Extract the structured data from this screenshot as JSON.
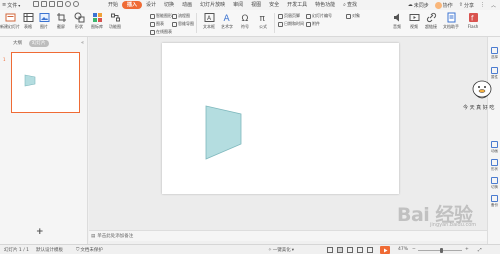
{
  "titlebar": {
    "file_menu": "文件",
    "tabs": [
      {
        "label": "开始",
        "active": false
      },
      {
        "label": "插入",
        "active": true
      },
      {
        "label": "设计",
        "active": false
      },
      {
        "label": "切换",
        "active": false
      },
      {
        "label": "动画",
        "active": false
      },
      {
        "label": "幻灯片放映",
        "active": false
      },
      {
        "label": "审阅",
        "active": false
      },
      {
        "label": "视图",
        "active": false
      },
      {
        "label": "安全",
        "active": false
      },
      {
        "label": "开发工具",
        "active": false
      },
      {
        "label": "特色功能",
        "active": false
      },
      {
        "label": "查找",
        "active": false
      }
    ],
    "right": {
      "collab": "未同步",
      "cooperate": "协作",
      "share": "分享"
    }
  },
  "ribbon": {
    "buttons": [
      {
        "label": "新建幻灯片",
        "icon": "new-slide-icon"
      },
      {
        "label": "表格",
        "icon": "table-icon"
      },
      {
        "label": "图片",
        "icon": "picture-icon"
      },
      {
        "label": "截屏",
        "icon": "screenshot-icon"
      },
      {
        "label": "形状",
        "icon": "shape-icon"
      },
      {
        "label": "图标库",
        "icon": "icon-library-icon"
      },
      {
        "label": "功能图",
        "icon": "function-chart-icon"
      },
      {
        "label": "文本框",
        "icon": "textbox-icon"
      },
      {
        "label": "艺术字",
        "icon": "wordart-icon"
      },
      {
        "label": "符号",
        "icon": "symbol-icon"
      },
      {
        "label": "公式",
        "icon": "formula-icon"
      },
      {
        "label": "音频",
        "icon": "audio-icon"
      },
      {
        "label": "视频",
        "icon": "video-icon"
      },
      {
        "label": "超链接",
        "icon": "hyperlink-icon"
      },
      {
        "label": "文档助手",
        "icon": "doc-assistant-icon"
      },
      {
        "label": "Flash",
        "icon": "flash-icon"
      }
    ],
    "small": [
      {
        "label": "智能图形"
      },
      {
        "label": "图表"
      },
      {
        "label": "在线图表"
      },
      {
        "label": "流程图"
      },
      {
        "label": "思维导图"
      },
      {
        "label": "页眉页脚"
      },
      {
        "label": "幻灯片编号"
      },
      {
        "label": "日期和时间"
      },
      {
        "label": "附件"
      },
      {
        "label": "对象"
      }
    ]
  },
  "leftpanel": {
    "tabs": [
      {
        "label": "大纲",
        "active": false
      },
      {
        "label": "幻灯片",
        "active": true
      }
    ],
    "slide_number": "1",
    "add_slide": "+"
  },
  "notes": {
    "placeholder": "单击此处添加备注"
  },
  "rightbar": {
    "items": [
      {
        "label": "选择",
        "icon": "select-icon"
      },
      {
        "label": "属性",
        "icon": "property-icon"
      },
      {
        "label": "动画",
        "icon": "animation-icon"
      },
      {
        "label": "形状",
        "icon": "shape-panel-icon"
      },
      {
        "label": "切换",
        "icon": "transition-icon"
      },
      {
        "label": "备份",
        "icon": "backup-icon"
      }
    ]
  },
  "statusbar": {
    "slide_info": "幻灯片 1 / 1",
    "theme": "默认设计模板",
    "protect": "文档未保护",
    "beautify": "一键美化",
    "zoom": "47%"
  },
  "shape": {
    "fill": "#b4dde0",
    "stroke": "#7fb8bd"
  },
  "watermark": {
    "text": "Bai 经验",
    "sub": "jingyan.baidu.com"
  },
  "sticker": {
    "text": "今 天 真 好 吃"
  }
}
